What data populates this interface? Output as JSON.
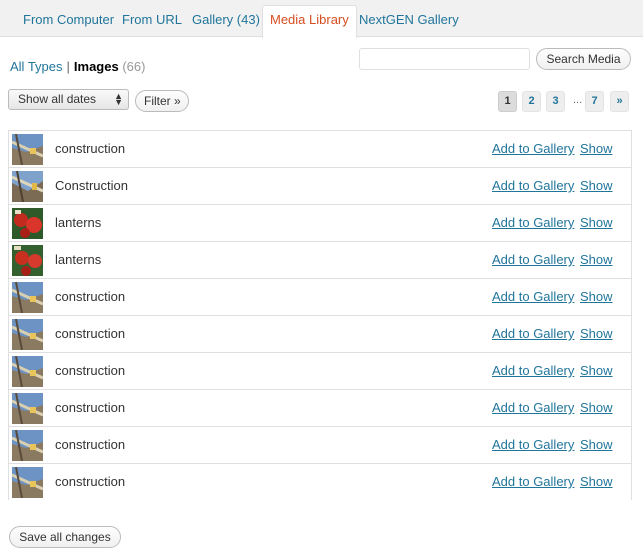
{
  "tabs": [
    {
      "label": "From Computer",
      "active": false
    },
    {
      "label": "From URL",
      "active": false
    },
    {
      "label": "Gallery (43)",
      "active": false
    },
    {
      "label": "Media Library",
      "active": true
    },
    {
      "label": "NextGEN Gallery",
      "active": false
    }
  ],
  "filters": {
    "all_types": "All Types",
    "separator": "|",
    "images_label": "Images",
    "images_count": "(66)"
  },
  "search": {
    "value": "",
    "button_label": "Search Media"
  },
  "date_filter": {
    "selected": "Show all dates",
    "arrow_up": "▲",
    "arrow_down": "▼"
  },
  "filter_button": "Filter »",
  "pagination": {
    "pages": [
      "1",
      "2",
      "3",
      "7"
    ],
    "current": "1",
    "ellipsis": "...",
    "next": "»"
  },
  "media_items": [
    {
      "title": "construction",
      "thumb": "construction-thumbnail",
      "add_label": "Add to Gallery",
      "show_label": "Show"
    },
    {
      "title": "Construction",
      "thumb": "construction-thumbnail",
      "add_label": "Add to Gallery",
      "show_label": "Show"
    },
    {
      "title": "lanterns",
      "thumb": "lanterns-thumbnail",
      "add_label": "Add to Gallery",
      "show_label": "Show"
    },
    {
      "title": "lanterns",
      "thumb": "lanterns-thumbnail",
      "add_label": "Add to Gallery",
      "show_label": "Show"
    },
    {
      "title": "construction",
      "thumb": "construction-thumbnail",
      "add_label": "Add to Gallery",
      "show_label": "Show"
    },
    {
      "title": "construction",
      "thumb": "construction-thumbnail",
      "add_label": "Add to Gallery",
      "show_label": "Show"
    },
    {
      "title": "construction",
      "thumb": "construction-thumbnail",
      "add_label": "Add to Gallery",
      "show_label": "Show"
    },
    {
      "title": "construction",
      "thumb": "construction-thumbnail",
      "add_label": "Add to Gallery",
      "show_label": "Show"
    },
    {
      "title": "construction",
      "thumb": "construction-thumbnail",
      "add_label": "Add to Gallery",
      "show_label": "Show"
    },
    {
      "title": "construction",
      "thumb": "construction-thumbnail",
      "add_label": "Add to Gallery",
      "show_label": "Show"
    }
  ],
  "save_button": "Save all changes",
  "colors": {
    "link": "#21759b",
    "active_tab": "#d54e21",
    "border": "#dfdfdf"
  }
}
